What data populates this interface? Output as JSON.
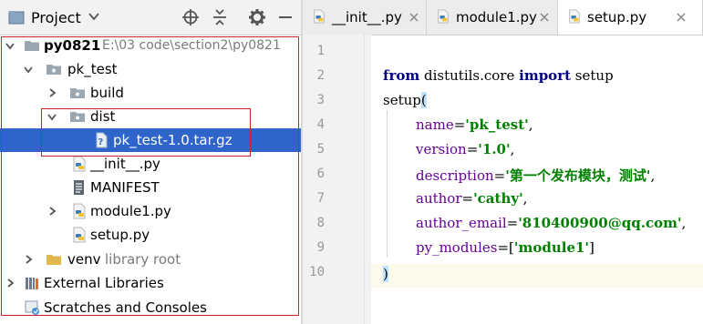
{
  "project_pane": {
    "title": "Project",
    "icons": [
      "project-window-icon",
      "dropdown-arrow-icon",
      "locate-icon",
      "collapse-all-icon",
      "settings-gear-icon",
      "hide-minus-icon"
    ],
    "tree": [
      {
        "label": "py0821",
        "path": "E:\\03 code\\section2\\py0821",
        "icon": "folder-icon",
        "expanded": true
      },
      {
        "label": "pk_test",
        "icon": "package-folder-icon",
        "expanded": true
      },
      {
        "label": "build",
        "icon": "folder-icon",
        "expanded": false
      },
      {
        "label": "dist",
        "icon": "folder-icon",
        "expanded": true
      },
      {
        "label": "pk_test-1.0.tar.gz",
        "icon": "archive-file-icon",
        "selected": true
      },
      {
        "label": "__init__.py",
        "icon": "python-file-icon"
      },
      {
        "label": "MANIFEST",
        "icon": "text-file-icon"
      },
      {
        "label": "module1.py",
        "icon": "python-file-icon",
        "expanded": false
      },
      {
        "label": "setup.py",
        "icon": "python-file-icon"
      },
      {
        "label": "venv",
        "suffix": "library root",
        "icon": "folder-icon",
        "expanded": false
      },
      {
        "label": "External Libraries",
        "icon": "libraries-icon",
        "expanded": false
      },
      {
        "label": "Scratches and Consoles",
        "icon": "scratches-icon"
      }
    ]
  },
  "editor": {
    "tabs": [
      {
        "label": "__init__.py",
        "icon": "python-file-icon",
        "active": false
      },
      {
        "label": "module1.py",
        "icon": "python-file-icon",
        "active": false
      },
      {
        "label": "setup.py",
        "icon": "python-file-icon",
        "active": true
      }
    ],
    "line_numbers": [
      "1",
      "2",
      "3",
      "4",
      "5",
      "6",
      "7",
      "8",
      "9",
      "10"
    ],
    "code": {
      "l2_kw_from": "from",
      "l2_module": " distutils.core ",
      "l2_kw_import": "import",
      "l2_name": " setup",
      "l3_func": "setup",
      "l3_paren": "(",
      "l4_key": "name",
      "l4_eq": "=",
      "l4_val": "'pk_test'",
      "l4_comma": ",",
      "l5_key": "version",
      "l5_eq": "=",
      "l5_val": "'1.0'",
      "l5_comma": ",",
      "l6_key": "description",
      "l6_eq": "=",
      "l6_val": "'第一个发布模块，测试'",
      "l6_comma": ",",
      "l7_key": "author",
      "l7_eq": "=",
      "l7_val": "'cathy'",
      "l7_comma": ",",
      "l8_key": "author_email",
      "l8_eq": "=",
      "l8_val": "'810400900@qq.com'",
      "l8_comma": ",",
      "l9_key": "py_modules",
      "l9_eq": "=[",
      "l9_val": "'module1'",
      "l9_close": "]",
      "l10_paren": ")"
    }
  },
  "colors": {
    "selection": "#2f65ca",
    "highlight_box": "#d0202a",
    "keyword": "#000080",
    "string": "#008000",
    "kwarg": "#660099"
  }
}
